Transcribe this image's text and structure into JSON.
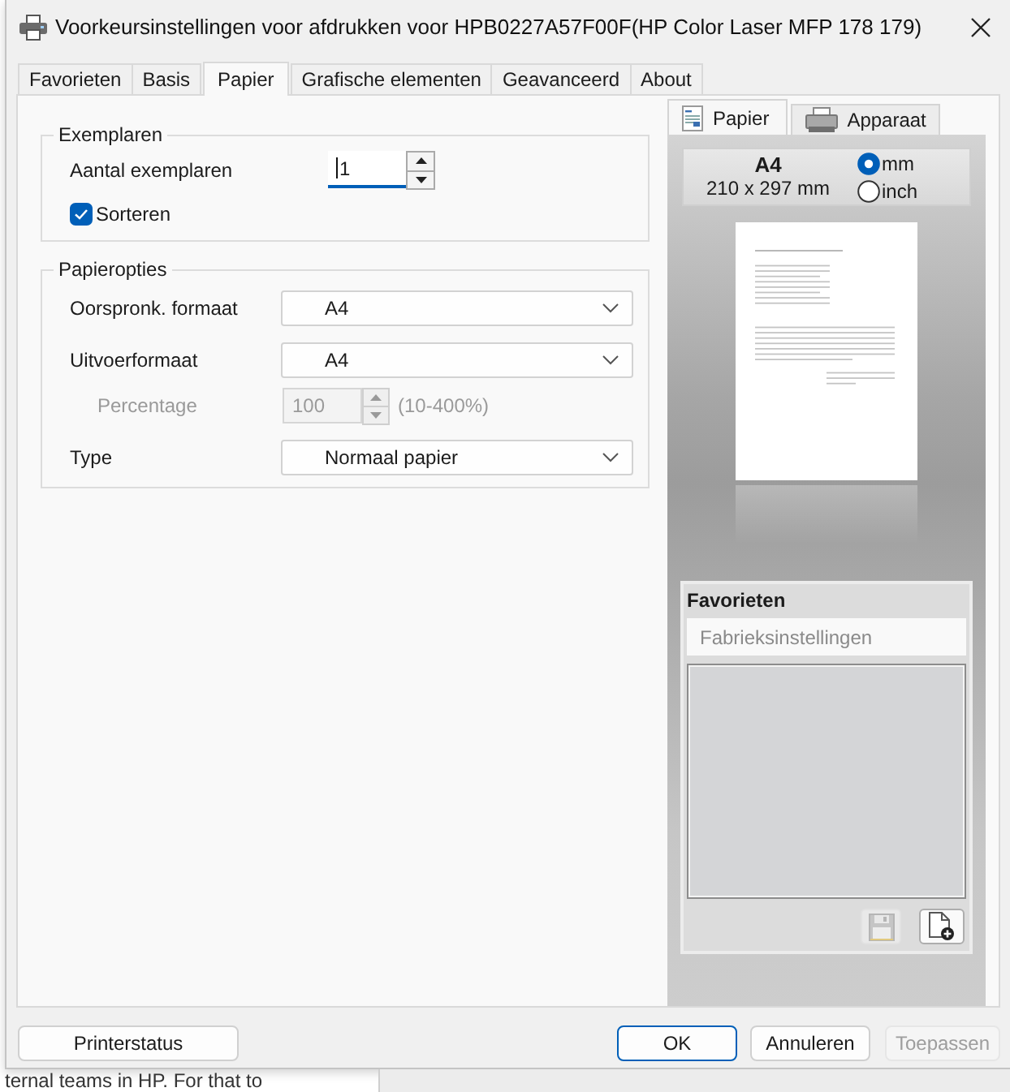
{
  "window": {
    "title": "Voorkeursinstellingen voor afdrukken voor HPB0227A57F00F(HP Color Laser MFP 178 179)"
  },
  "tabs": [
    {
      "label": "Favorieten",
      "selected": false
    },
    {
      "label": "Basis",
      "selected": false
    },
    {
      "label": "Papier",
      "selected": true
    },
    {
      "label": "Grafische elementen",
      "selected": false
    },
    {
      "label": "Geavanceerd",
      "selected": false
    },
    {
      "label": "About",
      "selected": false
    }
  ],
  "copies_group": {
    "title": "Exemplaren",
    "copies": {
      "label": "Aantal exemplaren",
      "value": "1"
    },
    "collate": {
      "label": "Sorteren",
      "checked": true
    }
  },
  "paper_group": {
    "title": "Papieropties",
    "rows": [
      {
        "kind": "select",
        "label": "Oorspronk. formaat",
        "value": "A4",
        "disabled": false
      },
      {
        "kind": "select",
        "label": "Uitvoerformaat",
        "value": "A4",
        "disabled": false
      },
      {
        "kind": "spin",
        "label": "Percentage",
        "value": "100",
        "range": "(10-400%)",
        "disabled": true
      },
      {
        "kind": "select",
        "label": "Type",
        "value": "Normaal papier",
        "disabled": false
      }
    ]
  },
  "preview": {
    "tabs": [
      {
        "kind": "paper",
        "label": "Papier",
        "selected": true
      },
      {
        "kind": "device",
        "label": "Apparaat",
        "selected": false
      }
    ],
    "size_name": "A4",
    "size_dims": "210 x 297 mm",
    "units": [
      {
        "label": "mm",
        "selected": true
      },
      {
        "label": "inch",
        "selected": false
      }
    ]
  },
  "favorites": {
    "title": "Favorieten",
    "current": "Fabrieksinstellingen",
    "buttons": [
      {
        "kind": "save",
        "disabled": true
      },
      {
        "kind": "new",
        "disabled": false
      }
    ]
  },
  "status_button": {
    "label": "Printerstatus"
  },
  "buttons": [
    {
      "label": "OK",
      "default": true,
      "disabled": false
    },
    {
      "label": "Annuleren",
      "default": false,
      "disabled": false
    },
    {
      "label": "Toepassen",
      "default": false,
      "disabled": true
    }
  ],
  "background": {
    "text": "ternal teams in HP. For that to"
  }
}
